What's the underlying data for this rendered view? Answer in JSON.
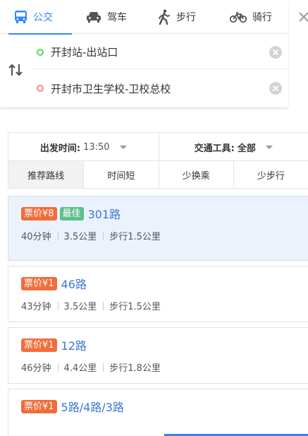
{
  "modes": [
    {
      "label": "公交",
      "icon": "bus-icon",
      "active": true
    },
    {
      "label": "驾车",
      "icon": "car-icon",
      "active": false
    },
    {
      "label": "步行",
      "icon": "walk-icon",
      "active": false
    },
    {
      "label": "骑行",
      "icon": "bike-icon",
      "active": false
    }
  ],
  "search": {
    "start": "开封站-出站口",
    "end": "开封市卫生学校-卫校总校"
  },
  "filters": {
    "depart_key": "出发时间:",
    "depart_value": "13:50",
    "transport_key": "交通工具:",
    "transport_value": "全部",
    "tabs": [
      "推荐路线",
      "时间短",
      "少换乘",
      "少步行"
    ]
  },
  "routes": [
    {
      "price": "票价¥8",
      "best": "最佳",
      "name": "301路",
      "time": "40分钟",
      "distance": "3.5公里",
      "walk": "步行1.5公里"
    },
    {
      "price": "票价¥1",
      "name": "46路",
      "time": "43分钟",
      "distance": "3.5公里",
      "walk": "步行1.5公里"
    },
    {
      "price": "票价¥1",
      "name": "12路",
      "time": "46分钟",
      "distance": "4.4公里",
      "walk": "步行1.8公里"
    },
    {
      "price": "票价¥1",
      "name": "5路/4路/3路"
    }
  ],
  "colors": {
    "accent": "#3385ff",
    "price_badge": "#f16c3a",
    "best_badge": "#5cc08a",
    "route_name": "#3d78d4",
    "selected_card": "#ebf2fc"
  }
}
